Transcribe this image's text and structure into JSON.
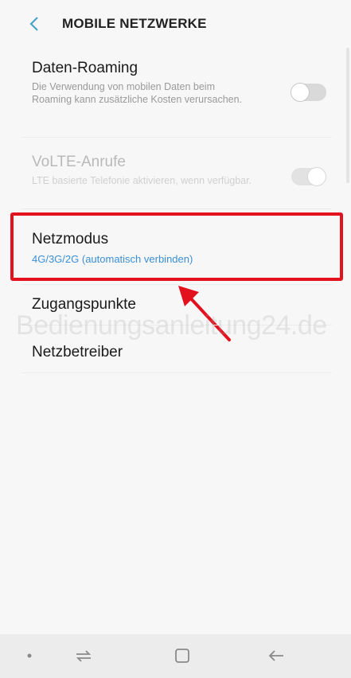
{
  "header": {
    "title": "MOBILE NETZWERKE"
  },
  "settings": [
    {
      "label": "Daten-Roaming",
      "description": "Die Verwendung von mobilen Daten beim Roaming kann zusätzliche Kosten verursachen.",
      "toggle": false,
      "enabled": true
    },
    {
      "label": "VoLTE-Anrufe",
      "description": "LTE basierte Telefonie aktivieren, wenn verfügbar.",
      "toggle": false,
      "enabled": false
    },
    {
      "label": "Netzmodus",
      "value": "4G/3G/2G (automatisch verbinden)",
      "highlighted": true
    },
    {
      "label": "Zugangspunkte"
    },
    {
      "label": "Netzbetreiber"
    }
  ],
  "watermark": "Bedienungsanleitung24.de",
  "colors": {
    "highlight": "#e3101e",
    "accent": "#3a8fd6",
    "arrow": "#e3101e"
  },
  "navbar": {
    "items": [
      "dot-icon",
      "recents-icon",
      "home-icon",
      "back-icon"
    ]
  }
}
